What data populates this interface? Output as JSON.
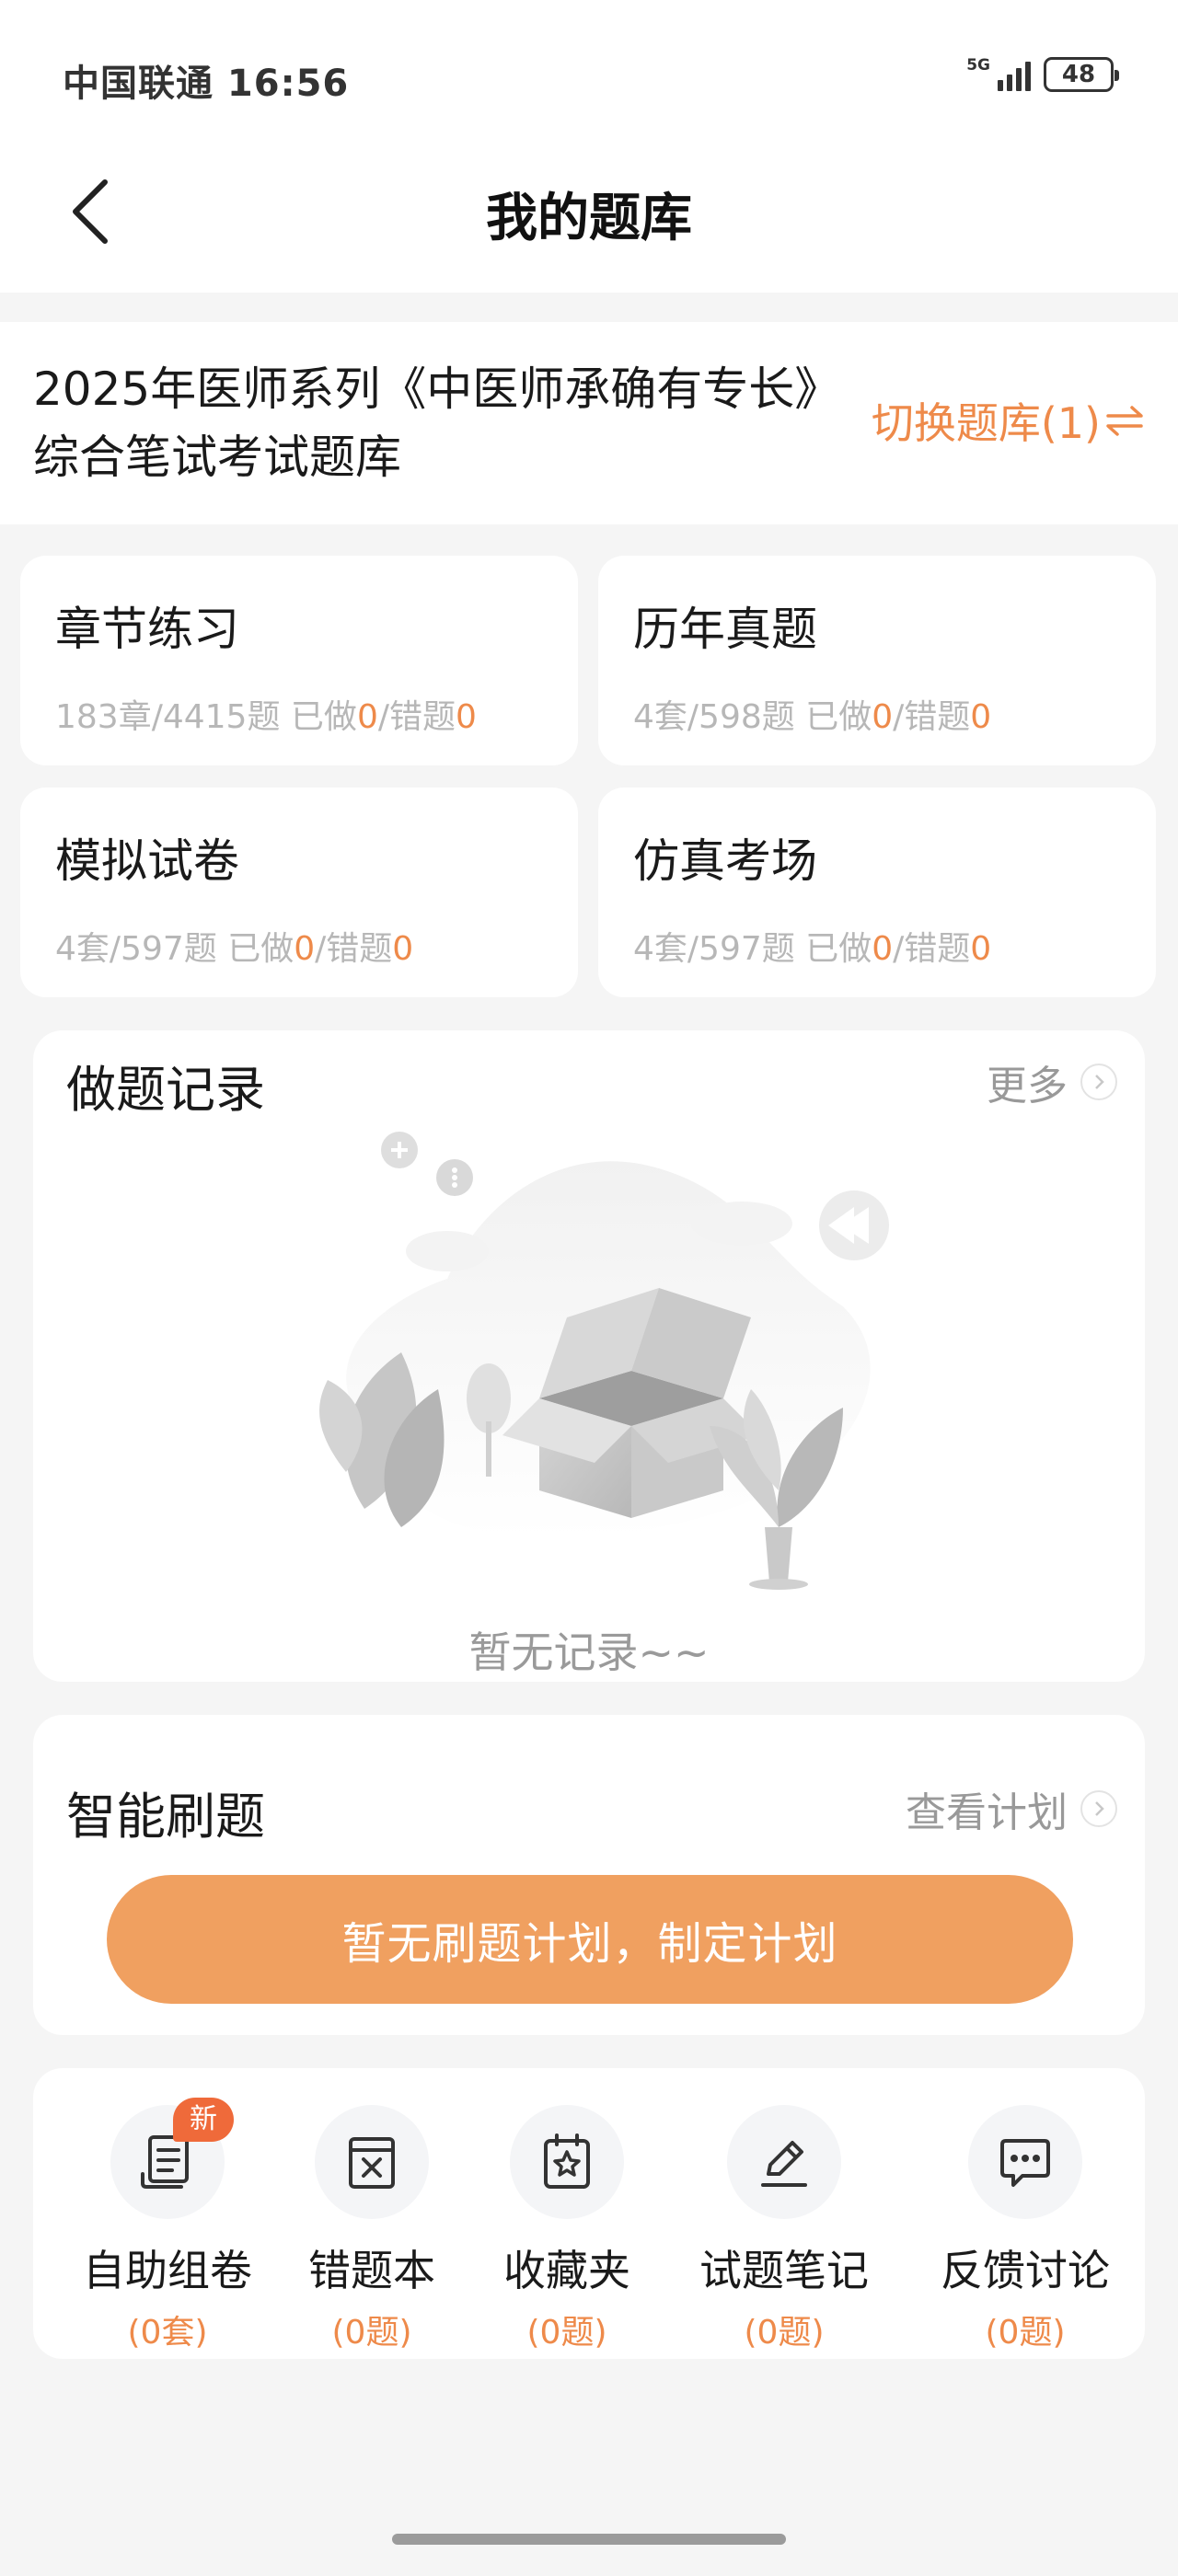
{
  "status_bar": {
    "carrier_time": "中国联通 16:56",
    "network": "5G",
    "battery": "48"
  },
  "header": {
    "title": "我的题库"
  },
  "bank": {
    "name": "2025年医师系列《中医师承确有专长》综合笔试考试题库",
    "switch_label": "切换题库(1)"
  },
  "cards": [
    {
      "title": "章节练习",
      "count": "183章/4415题",
      "done_label": "已做",
      "done": "0",
      "wrong_label": "/错题",
      "wrong": "0"
    },
    {
      "title": "历年真题",
      "count": "4套/598题",
      "done_label": "已做",
      "done": "0",
      "wrong_label": "/错题",
      "wrong": "0"
    },
    {
      "title": "模拟试卷",
      "count": "4套/597题",
      "done_label": "已做",
      "done": "0",
      "wrong_label": "/错题",
      "wrong": "0"
    },
    {
      "title": "仿真考场",
      "count": "4套/597题",
      "done_label": "已做",
      "done": "0",
      "wrong_label": "/错题",
      "wrong": "0"
    }
  ],
  "records": {
    "title": "做题记录",
    "more": "更多",
    "empty": "暂无记录~~"
  },
  "smart": {
    "title": "智能刷题",
    "more": "查看计划",
    "button": "暂无刷题计划，制定计划"
  },
  "tools": [
    {
      "label": "自助组卷",
      "count": "(0套)",
      "badge": "新",
      "icon": "document-list-icon"
    },
    {
      "label": "错题本",
      "count": "(0题)",
      "icon": "wrong-book-icon"
    },
    {
      "label": "收藏夹",
      "count": "(0题)",
      "icon": "star-folder-icon"
    },
    {
      "label": "试题笔记",
      "count": "(0题)",
      "icon": "pen-note-icon"
    },
    {
      "label": "反馈讨论",
      "count": "(0题)",
      "icon": "chat-bubble-icon"
    }
  ],
  "colors": {
    "accent": "#ee8a4a",
    "button": "#f0a060",
    "badge": "#ef6a3a",
    "background": "#f5f5f5"
  }
}
